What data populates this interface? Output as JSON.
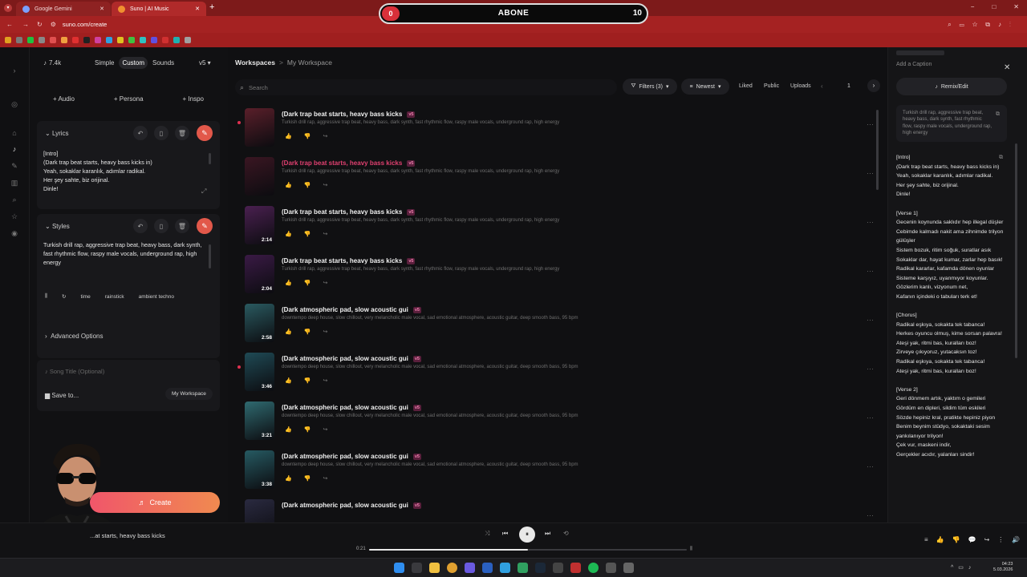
{
  "browser": {
    "tabs": [
      {
        "label": "Google Gemini",
        "active": false
      },
      {
        "label": "Suno | AI Music",
        "active": true
      }
    ],
    "url": "suno.com/create",
    "new_tab": "+",
    "window_controls": [
      "−",
      "□",
      "✕"
    ]
  },
  "overlay": {
    "left": "0",
    "center": "ABONE",
    "right": "10"
  },
  "creator": {
    "credits": "7.4k",
    "modes": [
      "Simple",
      "Custom",
      "Sounds"
    ],
    "version": "v5",
    "add_buttons": [
      "Audio",
      "Persona",
      "Inspo"
    ],
    "lyrics_label": "Lyrics",
    "lyrics_text": "[Intro]\n(Dark trap beat starts, heavy bass kicks in)\nYeah, sokaklar karanlık, adımlar radikal.\nHer şey sahte, biz orijinal.\nDinle!",
    "styles_label": "Styles",
    "styles_text": "Turkish drill rap, aggressive trap beat, heavy bass, dark synth, fast rhythmic flow, raspy male vocals, underground rap, high energy",
    "style_chips": [
      "time",
      "rainstick",
      "ambient techno"
    ],
    "advanced": "Advanced Options",
    "song_title_placeholder": "Song Title (Optional)",
    "save_to": "Save to...",
    "workspace": "My Workspace",
    "create": "Create"
  },
  "main": {
    "breadcrumb_root": "Workspaces",
    "breadcrumb_sep": ">",
    "breadcrumb_current": "My Workspace",
    "search_placeholder": "Search",
    "filters": "Filters (3)",
    "sort": "Newest",
    "tabs": [
      "Liked",
      "Public",
      "Uploads"
    ],
    "page": "1",
    "songs": [
      {
        "title": "(Dark trap beat starts, heavy bass kicks",
        "badge": "v5",
        "tags": "Turkish drill rap, aggressive trap beat, heavy bass, dark synth, fast rhythmic flow, raspy male vocals, underground rap, high energy",
        "duration": "",
        "highlight": false,
        "dot": true,
        "thumb_color": "#5a1f2a"
      },
      {
        "title": "(Dark trap beat starts, heavy bass kicks",
        "badge": "v5",
        "tags": "Turkish drill rap, aggressive trap beat, heavy bass, dark synth, fast rhythmic flow, raspy male vocals, underground rap, high energy",
        "duration": "",
        "highlight": true,
        "dot": false,
        "thumb_color": "#3a1622"
      },
      {
        "title": "(Dark trap beat starts, heavy bass kicks",
        "badge": "v5",
        "tags": "Turkish drill rap, aggressive trap beat, heavy bass, dark synth, fast rhythmic flow, raspy male vocals, underground rap, high energy",
        "duration": "2:14",
        "highlight": false,
        "dot": false,
        "thumb_color": "#4a2050"
      },
      {
        "title": "(Dark trap beat starts, heavy bass kicks",
        "badge": "v5",
        "tags": "Turkish drill rap, aggressive trap beat, heavy bass, dark synth, fast rhythmic flow, raspy male vocals, underground rap, high energy",
        "duration": "2:04",
        "highlight": false,
        "dot": false,
        "thumb_color": "#3a1a45"
      },
      {
        "title": "(Dark atmospheric pad, slow acoustic gui",
        "badge": "v5",
        "tags": "downtempo deep house, slow chillout, very melancholic male vocal, sad emotional atmosphere, acoustic guitar, deep smooth bass, 95 bpm",
        "duration": "2:58",
        "highlight": false,
        "dot": false,
        "thumb_color": "#2a5a60"
      },
      {
        "title": "(Dark atmospheric pad, slow acoustic gui",
        "badge": "v5",
        "tags": "downtempo deep house, slow chillout, very melancholic male vocal, sad emotional atmosphere, acoustic guitar, deep smooth bass, 95 bpm",
        "duration": "3:46",
        "highlight": false,
        "dot": true,
        "thumb_color": "#1f4a55"
      },
      {
        "title": "(Dark atmospheric pad, slow acoustic gui",
        "badge": "v5",
        "tags": "downtempo deep house, slow chillout, very melancholic male vocal, sad emotional atmosphere, acoustic guitar, deep smooth bass, 95 bpm",
        "duration": "3:21",
        "highlight": false,
        "dot": false,
        "thumb_color": "#2f6a70"
      },
      {
        "title": "(Dark atmospheric pad, slow acoustic gui",
        "badge": "v5",
        "tags": "downtempo deep house, slow chillout, very melancholic male vocal, sad emotional atmosphere, acoustic guitar, deep smooth bass, 95 bpm",
        "duration": "3:38",
        "highlight": false,
        "dot": false,
        "thumb_color": "#265a62"
      },
      {
        "title": "(Dark atmospheric pad, slow acoustic gui",
        "badge": "v5",
        "tags": "",
        "duration": "",
        "highlight": false,
        "dot": false,
        "thumb_color": "#2a2a40"
      }
    ]
  },
  "detail": {
    "caption": "Add a Caption",
    "remix": "Remix/Edit",
    "style_text": "Turkish drill rap, aggressive trap beat, heavy bass, dark synth, fast rhythmic flow, raspy male vocals, underground rap, high energy",
    "lyrics": "[Intro]\n(Dark trap beat starts, heavy bass kicks in)\nYeah, sokaklar karanlık, adımlar radikal.\nHer şey sahte, biz orijinal.\nDinle!\n\n[Verse 1]\nGecenin koynunda saklıdır hep illegal düşler\nCebimde kalmadı nakit ama zihnimde trilyon gülüşler\nSistem bozuk, ritim soğuk, suratlar asık\nSokaklar dar, hayat kumar, zarlar hep basık!\nRadikal kararlar, kafamda dönen oyunlar\nSisteme karşıyız, uyanmıyor koyunlar.\nGözlerim kanlı, vizyonum net,\nKafanın içindeki o tabuları terk et!\n\n[Chorus]\nRadikal eşkıya, sokakta tek tabanca!\nHerkes oyuncu olmuş, kime sorsan palavra!\nAteşi yak, ritmi bas, kuralları boz!\nZirveye çıkıyoruz, yutacaksın toz!\nRadikal eşkıya, sokakta tek tabanca!\nAteşi yak, ritmi bas, kuralları boz!\n\n[Verse 2]\nGeri dönmem artık, yaktım o gemileri\nGördüm en dipleri, sildim tüm eskileri\nSözde hepiniz kral, pratikte hepiniz piyon\nBenim beynim stüdyo, sokaktaki sesim yankılanıyor trilyon!\nÇek vur, maskeni indir,\nGerçekler acıdır, yalanları sindir!"
  },
  "player": {
    "now_playing": "...at starts, heavy bass kicks",
    "time": "0:21",
    "progress": 0.5
  },
  "taskbar": {
    "time": "04:23",
    "date": "5.03.2026"
  }
}
